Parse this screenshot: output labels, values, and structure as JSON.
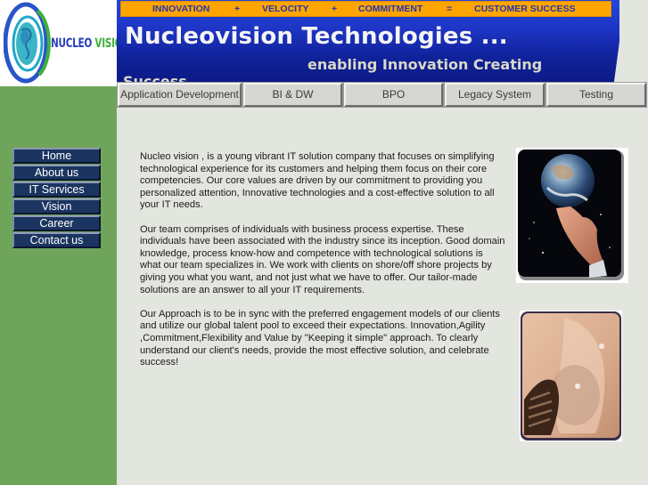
{
  "logo": {
    "alt": "Nucleo Vision logo",
    "text_part1": "NUCLEO",
    "text_part2": "VISION"
  },
  "tagline": {
    "items": [
      "INNOVATION",
      "+",
      "VELOCITY",
      "+",
      "COMMITMENT",
      "=",
      "CUSTOMER SUCCESS"
    ]
  },
  "header": {
    "title": "Nucleovision Technologies ...",
    "subtitle": "enabling Innovation Creating",
    "subtitle_wrap": "Success"
  },
  "top_nav": {
    "items": [
      {
        "label": "Application Development"
      },
      {
        "label": "BI & DW"
      },
      {
        "label": "BPO"
      },
      {
        "label": "Legacy System"
      },
      {
        "label": "Testing"
      }
    ]
  },
  "side_nav": {
    "items": [
      {
        "label": "Home"
      },
      {
        "label": "About us"
      },
      {
        "label": "IT Services"
      },
      {
        "label": "Vision"
      },
      {
        "label": "Career"
      },
      {
        "label": "Contact us"
      }
    ]
  },
  "content": {
    "paragraphs": [
      "Nucleo vision , is a young vibrant IT solution company that focuses on simplifying technological experience for its customers and helping them focus on their core competencies. Our core values are driven by our commitment to providing you personalized attention, Innovative technologies and a cost-effective solution to all your IT needs.",
      "Our team comprises of individuals with business process expertise. These individuals have been associated with the industry since its inception.  Good domain knowledge, process know-how and competence with technological solutions is what our team specializes in. We work with clients on shore/off shore projects by giving you what you want, and not just what we have to offer. Our tailor-made solutions are an answer to all your IT requirements.",
      "Our Approach is to be in sync with the preferred engagement models of our clients and utilize our global talent pool to exceed their expectations. Innovation,Agility ,Commitment,Flexibility and Value by \"Keeping it simple\" approach. To clearly understand our client's needs, provide the most effective solution, and celebrate success!"
    ]
  },
  "images": {
    "globe": "hand-holding-globe-image",
    "bulb": "light-bulb-image"
  },
  "colors": {
    "sidebar_green": "#6fa55a",
    "header_blue": "#1d35c5",
    "tagline_orange": "#ffa500",
    "tagline_text": "#2534b0",
    "nav_button_navy": "#1b3560",
    "page_bg": "#e3e6df"
  }
}
